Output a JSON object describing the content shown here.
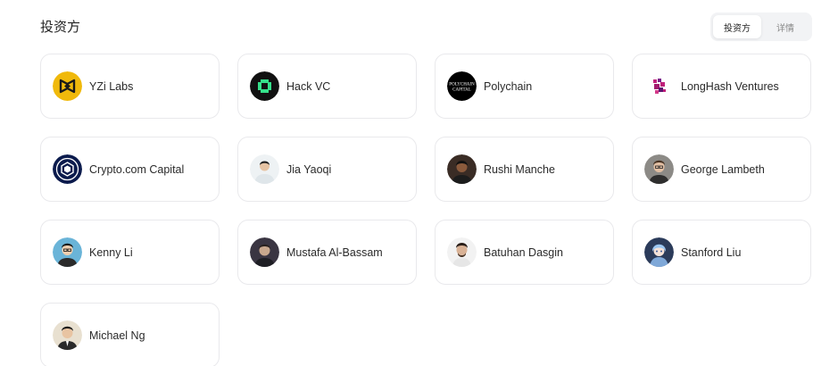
{
  "section": {
    "title": "投资方"
  },
  "toggle": {
    "tabs": [
      "投资方",
      "详情"
    ],
    "active": 0
  },
  "investors": [
    {
      "name": "YZi Labs",
      "avatar": "yzi-labs-logo"
    },
    {
      "name": "Hack VC",
      "avatar": "hack-vc-logo"
    },
    {
      "name": "Polychain",
      "avatar": "polychain-logo",
      "logo_text": [
        "POLYCHAIN",
        "CAPITAL"
      ]
    },
    {
      "name": "LongHash Ventures",
      "avatar": "longhash-logo"
    },
    {
      "name": "Crypto.com Capital",
      "avatar": "crypto-com-logo"
    },
    {
      "name": "Jia Yaoqi",
      "avatar": "person-photo"
    },
    {
      "name": "Rushi Manche",
      "avatar": "person-photo"
    },
    {
      "name": "George Lambeth",
      "avatar": "person-photo"
    },
    {
      "name": "Kenny Li",
      "avatar": "person-photo"
    },
    {
      "name": "Mustafa Al-Bassam",
      "avatar": "person-photo"
    },
    {
      "name": "Batuhan Dasgin",
      "avatar": "person-photo"
    },
    {
      "name": "Stanford Liu",
      "avatar": "person-photo"
    },
    {
      "name": "Michael Ng",
      "avatar": "person-photo"
    }
  ],
  "colors": {
    "yzi": "#f0b90b",
    "crypto_com": "#0b1b4d",
    "longhash": "#c0207a",
    "hack_vc_accent": "#35e08a"
  }
}
